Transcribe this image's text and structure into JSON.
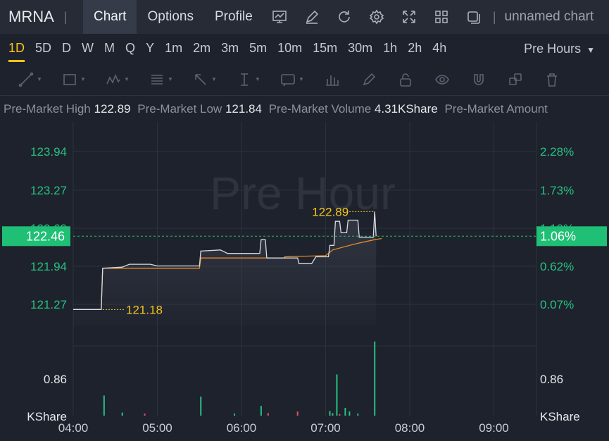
{
  "topbar": {
    "symbol": "MRNA",
    "tabs": [
      "Chart",
      "Options",
      "Profile"
    ],
    "chart_name": "unnamed chart"
  },
  "periods": [
    "1D",
    "5D",
    "D",
    "W",
    "M",
    "Q",
    "Y",
    "1m",
    "2m",
    "3m",
    "5m",
    "10m",
    "15m",
    "30m",
    "1h",
    "2h",
    "4h"
  ],
  "active_period": "1D",
  "session": "Pre Hours",
  "drawing_tools": [
    "trend-line-icon",
    "rectangle-icon",
    "pattern-icon",
    "fib-icon",
    "arrow-icon",
    "measure-icon",
    "text-note-icon",
    "bars-icon",
    "pencil-icon",
    "lock-icon",
    "eye-icon",
    "magnet-icon",
    "layers-icon",
    "trash-icon"
  ],
  "info": {
    "high_label": "Pre-Market High",
    "high_value": "122.89",
    "low_label": "Pre-Market Low",
    "low_value": "121.84",
    "volume_label": "Pre-Market Volume",
    "volume_value": "4.31KShare",
    "amount_label": "Pre-Market Amount"
  },
  "colors": {
    "up": "#26c281",
    "down": "#e05260",
    "price_line": "#d9dbe0",
    "avg_line": "#e58a2a",
    "marker": "#f5c518",
    "current_tag": "#1fbf75"
  },
  "chart_data": {
    "type": "line",
    "watermark": "Pre Hour",
    "x_ticks": [
      "04:00",
      "05:00",
      "06:00",
      "07:00",
      "08:00",
      "09:00"
    ],
    "y_left_ticks": [
      "123.94",
      "123.27",
      "122.60",
      "121.94",
      "121.27"
    ],
    "y_right_ticks": [
      "2.28%",
      "1.73%",
      "1.10%",
      "0.62%",
      "0.07%"
    ],
    "current_price": "122.46",
    "current_pct": "1.06%",
    "high_marker": "122.89",
    "low_marker": "121.18",
    "volume_tick": "0.86",
    "volume_unit": "KShare",
    "price": [
      [
        "04:00",
        121.18
      ],
      [
        "04:20",
        121.18
      ],
      [
        "04:21",
        121.9
      ],
      [
        "04:35",
        121.92
      ],
      [
        "04:40",
        121.97
      ],
      [
        "04:55",
        121.97
      ],
      [
        "05:00",
        121.94
      ],
      [
        "05:30",
        121.94
      ],
      [
        "05:31",
        122.2
      ],
      [
        "05:45",
        122.22
      ],
      [
        "05:50",
        122.16
      ],
      [
        "06:13",
        122.16
      ],
      [
        "06:14",
        122.4
      ],
      [
        "06:17",
        122.4
      ],
      [
        "06:18",
        122.08
      ],
      [
        "06:40",
        122.08
      ],
      [
        "06:41",
        121.98
      ],
      [
        "06:50",
        121.98
      ],
      [
        "06:53",
        122.1
      ],
      [
        "07:02",
        122.1
      ],
      [
        "07:03",
        122.3
      ],
      [
        "07:06",
        122.3
      ],
      [
        "07:07",
        122.72
      ],
      [
        "07:10",
        122.72
      ],
      [
        "07:11",
        122.52
      ],
      [
        "07:15",
        122.52
      ],
      [
        "07:16",
        122.74
      ],
      [
        "07:23",
        122.74
      ],
      [
        "07:24",
        122.44
      ],
      [
        "07:34",
        122.44
      ],
      [
        "07:35",
        122.89
      ],
      [
        "07:36",
        122.46
      ]
    ],
    "avg_price": [
      [
        "04:00",
        121.18
      ],
      [
        "04:20",
        121.18
      ],
      [
        "04:21",
        121.9
      ],
      [
        "05:30",
        121.9
      ],
      [
        "05:31",
        122.08
      ],
      [
        "06:30",
        122.08
      ],
      [
        "06:31",
        122.1
      ],
      [
        "07:00",
        122.12
      ],
      [
        "07:05",
        122.22
      ],
      [
        "07:20",
        122.32
      ],
      [
        "07:35",
        122.4
      ],
      [
        "07:40",
        122.42
      ]
    ],
    "volume": [
      [
        "04:22",
        0.39,
        "up"
      ],
      [
        "04:35",
        0.06,
        "up"
      ],
      [
        "04:51",
        0.04,
        "down"
      ],
      [
        "05:31",
        0.37,
        "up"
      ],
      [
        "05:55",
        0.04,
        "up"
      ],
      [
        "06:14",
        0.19,
        "up"
      ],
      [
        "06:19",
        0.05,
        "down"
      ],
      [
        "06:40",
        0.08,
        "down"
      ],
      [
        "07:03",
        0.09,
        "up"
      ],
      [
        "07:05",
        0.05,
        "up"
      ],
      [
        "07:08",
        0.8,
        "up"
      ],
      [
        "07:10",
        0.03,
        "down"
      ],
      [
        "07:14",
        0.15,
        "up"
      ],
      [
        "07:17",
        0.08,
        "up"
      ],
      [
        "07:23",
        0.04,
        "up"
      ],
      [
        "07:35",
        1.44,
        "up"
      ]
    ]
  }
}
